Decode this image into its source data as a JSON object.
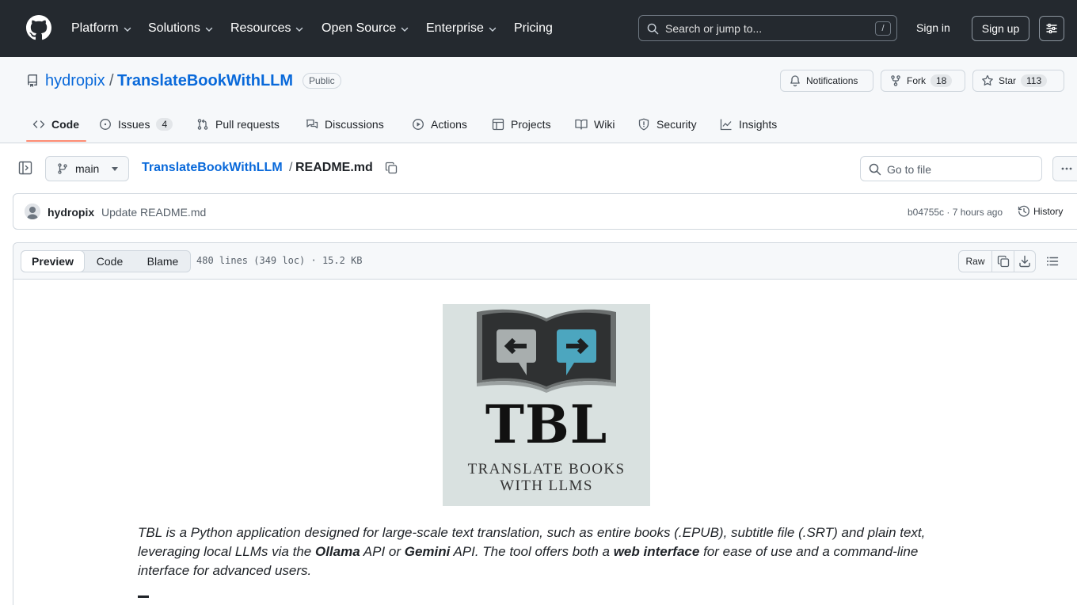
{
  "header": {
    "nav": [
      "Platform",
      "Solutions",
      "Resources",
      "Open Source",
      "Enterprise",
      "Pricing"
    ],
    "search_placeholder": "Search or jump to...",
    "search_shortcut": "/",
    "sign_in": "Sign in",
    "sign_up": "Sign up"
  },
  "repo": {
    "owner": "hydropix",
    "separator": "/",
    "name": "TranslateBookWithLLM",
    "visibility": "Public",
    "notifications_label": "Notifications",
    "fork_label": "Fork",
    "fork_count": "18",
    "star_label": "Star",
    "star_count": "113"
  },
  "tabs": [
    {
      "label": "Code",
      "active": true
    },
    {
      "label": "Issues",
      "count": "4"
    },
    {
      "label": "Pull requests"
    },
    {
      "label": "Discussions"
    },
    {
      "label": "Actions"
    },
    {
      "label": "Projects"
    },
    {
      "label": "Wiki"
    },
    {
      "label": "Security"
    },
    {
      "label": "Insights"
    }
  ],
  "file_nav": {
    "branch": "main",
    "breadcrumb_repo": "TranslateBookWithLLM",
    "breadcrumb_sep": "/",
    "breadcrumb_file": "README.md",
    "goto_placeholder": "Go to file"
  },
  "commit": {
    "author": "hydropix",
    "message": "Update README.md",
    "meta": "b04755c · 7 hours ago",
    "history_label": "History"
  },
  "viewer": {
    "modes": [
      "Preview",
      "Code",
      "Blame"
    ],
    "active_mode": "Preview",
    "info": "480 lines (349 loc) · 15.2 KB",
    "raw_label": "Raw"
  },
  "readme": {
    "logo_title": "TBL",
    "logo_sub1": "TRANSLATE BOOKS",
    "logo_sub2": "WITH LLMS",
    "intro": {
      "p1": "TBL is a Python application designed for large-scale text translation, such as entire books (.EPUB), subtitle file (.SRT) and plain text, leveraging local LLMs via the ",
      "b1": "Ollama",
      "p2": " API or ",
      "b2": "Gemini",
      "p3": " API. The tool offers both a ",
      "b3": "web interface",
      "p4": " for ease of use and a command-line interface for advanced users."
    }
  },
  "colors": {
    "header_bg": "#24292f",
    "link": "#0969da",
    "tab_underline": "#fd8c73"
  }
}
